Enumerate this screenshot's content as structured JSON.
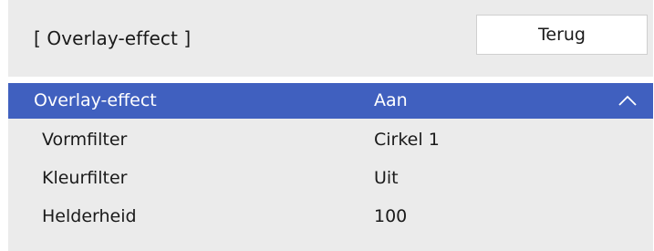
{
  "header": {
    "title": "[ Overlay-effect ]",
    "back_label": "Terug"
  },
  "menu": {
    "rows": [
      {
        "label": "Overlay-effect",
        "value": "Aan",
        "selected": true,
        "expander": "chevron-up-icon"
      },
      {
        "label": "Vormfilter",
        "value": "Cirkel 1",
        "selected": false
      },
      {
        "label": "Kleurfilter",
        "value": "Uit",
        "selected": false
      },
      {
        "label": "Helderheid",
        "value": "100",
        "selected": false
      }
    ]
  },
  "colors": {
    "panel_bg": "#ebebeb",
    "selected_bg": "#4060bf",
    "selected_text": "#ffffff",
    "text": "#1a1a1a"
  }
}
